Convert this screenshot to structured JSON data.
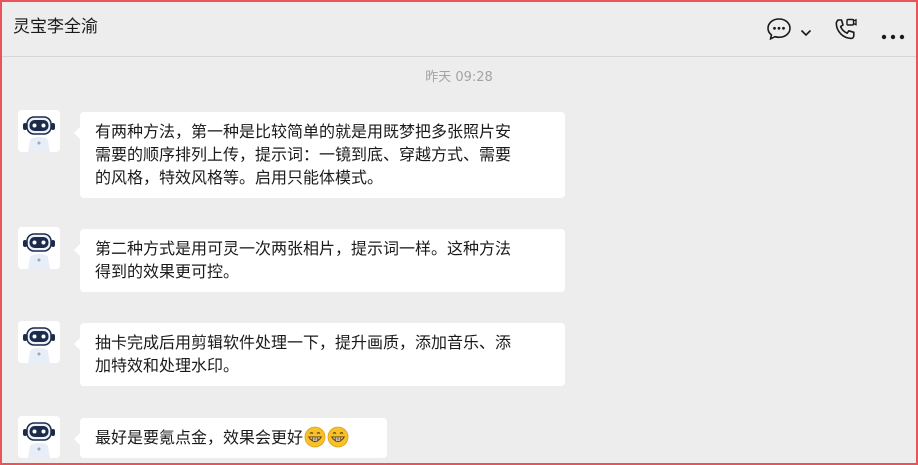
{
  "chat": {
    "title": "灵宝李全渝",
    "icons": [
      "chat-bubble-icon",
      "chevron-down-icon",
      "phone-video-icon",
      "more-icon"
    ]
  },
  "timestamp": "昨天 09:28",
  "messages": [
    {
      "sender_avatar": "robot-avatar",
      "lines": [
        "有两种方法，第一种是比较简单的就是用既梦把多张照片安",
        "需要的顺序排列上传，提示词：一镜到底、穿越方式、需要",
        "的风格，特效风格等。启用只能体模式。"
      ]
    },
    {
      "sender_avatar": "robot-avatar",
      "lines": [
        "第二种方式是用可灵一次两张相片，提示词一样。这种方法",
        "得到的效果更可控。"
      ]
    },
    {
      "sender_avatar": "robot-avatar",
      "lines": [
        "抽卡完成后用剪辑软件处理一下，提升画质，添加音乐、添",
        "加特效和处理水印。"
      ]
    },
    {
      "sender_avatar": "robot-avatar",
      "lines": [
        "最好是要氪点金，效果会更好"
      ],
      "emojis": [
        "grin-emoji",
        "grin-emoji"
      ]
    }
  ]
}
